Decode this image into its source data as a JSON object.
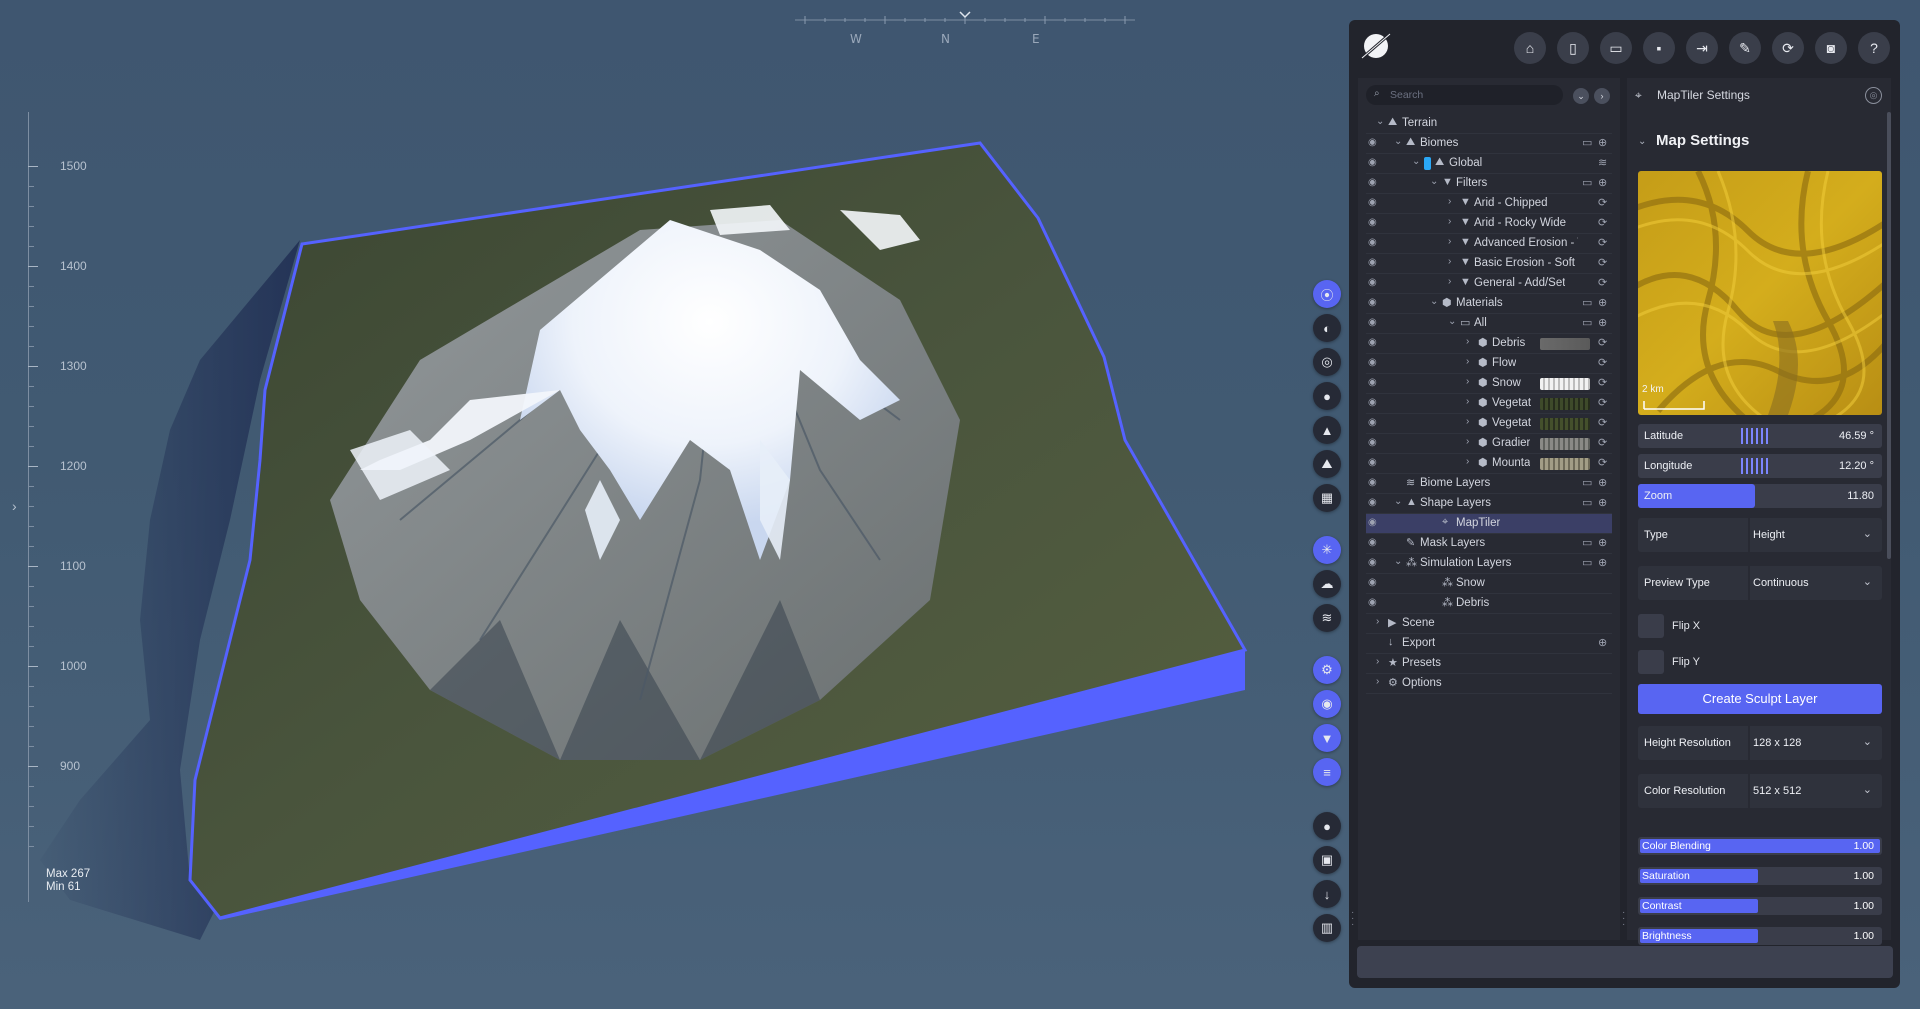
{
  "viewport": {
    "compass": {
      "w": "W",
      "n": "N",
      "e": "E"
    },
    "elevation_ticks": [
      "1500",
      "1400",
      "1300",
      "1200",
      "1100",
      "1000",
      "900"
    ],
    "minmax": {
      "max": "Max 267",
      "min": "Min 61"
    },
    "colors": {
      "terrain_edge": "#5562ff",
      "background": "#415a72"
    }
  },
  "toolstrip": [
    {
      "icon": "compass-icon",
      "active": true
    },
    {
      "icon": "globe-icon",
      "active": false
    },
    {
      "icon": "target-icon",
      "active": false
    },
    {
      "icon": "water-drop-icon",
      "active": false
    },
    {
      "icon": "mountain-icon",
      "active": false
    },
    {
      "icon": "landscape-icon",
      "active": false
    },
    {
      "icon": "grid-icon",
      "active": false
    },
    {
      "icon": "sun-icon",
      "active": true
    },
    {
      "icon": "cloud-icon",
      "active": false
    },
    {
      "icon": "wind-icon",
      "active": false
    },
    {
      "icon": "settings-gears-icon",
      "active": true
    },
    {
      "icon": "eye-icon",
      "active": true
    },
    {
      "icon": "filter-icon",
      "active": true
    },
    {
      "icon": "layers-icon",
      "active": true
    },
    {
      "icon": "record-icon",
      "active": false
    },
    {
      "icon": "image-icon",
      "active": false
    },
    {
      "icon": "download-icon",
      "active": false
    },
    {
      "icon": "chart-icon",
      "active": false
    }
  ],
  "toolbar": [
    "home-icon",
    "new-file-icon",
    "open-folder-icon",
    "save-icon",
    "export-file-icon",
    "edit-file-icon",
    "refresh-icon",
    "camera-icon",
    "help-icon"
  ],
  "search": {
    "placeholder": "Search"
  },
  "tree": [
    {
      "label": "Terrain",
      "indent": 0,
      "eye": false,
      "chev": "down",
      "icon": "terrain"
    },
    {
      "label": "Biomes",
      "indent": 1,
      "eye": true,
      "chev": "down",
      "icon": "biome",
      "act1": "folder",
      "act2": "plus"
    },
    {
      "label": "Global",
      "indent": 2,
      "eye": true,
      "chev": "down",
      "icon": "biome",
      "tag": true,
      "act2": "layers"
    },
    {
      "label": "Filters",
      "indent": 3,
      "eye": true,
      "chev": "down",
      "icon": "filter",
      "act1": "folder",
      "act2": "plus"
    },
    {
      "label": "Arid - Chipped",
      "indent": 4,
      "eye": true,
      "chev": "right",
      "icon": "filter",
      "act2": "sync"
    },
    {
      "label": "Arid - Rocky Wide",
      "indent": 4,
      "eye": true,
      "chev": "right",
      "icon": "filter",
      "act2": "sync"
    },
    {
      "label": "Advanced Erosion - W",
      "indent": 4,
      "eye": true,
      "chev": "right",
      "icon": "filter",
      "act2": "sync"
    },
    {
      "label": "Basic Erosion - Soft Fl",
      "indent": 4,
      "eye": true,
      "chev": "right",
      "icon": "filter",
      "act2": "sync"
    },
    {
      "label": "General - Add/Set",
      "indent": 4,
      "eye": true,
      "chev": "right",
      "icon": "filter",
      "act2": "sync"
    },
    {
      "label": "Materials",
      "indent": 3,
      "eye": true,
      "chev": "down",
      "icon": "material",
      "act1": "folder",
      "act2": "plus"
    },
    {
      "label": "All",
      "indent": 4,
      "eye": true,
      "chev": "down",
      "icon": "folder",
      "act1": "folder",
      "act2": "plus"
    },
    {
      "label": "Debris",
      "indent": 5,
      "eye": true,
      "chev": "right",
      "icon": "material",
      "act2": "sync",
      "swatch": "linear-gradient(90deg,#6a6a6a,#5a5a5a)"
    },
    {
      "label": "Flow",
      "indent": 5,
      "eye": true,
      "chev": "right",
      "icon": "material",
      "act2": "sync"
    },
    {
      "label": "Snow",
      "indent": 5,
      "eye": true,
      "chev": "right",
      "icon": "material",
      "act2": "sync",
      "swatch": "repeating-linear-gradient(90deg,#f2f2f2 0 3px,#bdbdbd 3px 5px)"
    },
    {
      "label": "Vegetat",
      "indent": 5,
      "eye": true,
      "chev": "right",
      "icon": "material",
      "act2": "sync",
      "swatch": "repeating-linear-gradient(90deg,#3e4a2a 0 3px,#262c1c 3px 5px)"
    },
    {
      "label": "Vegetat",
      "indent": 5,
      "eye": true,
      "chev": "right",
      "icon": "material",
      "act2": "sync",
      "swatch": "repeating-linear-gradient(90deg,#44502c 0 3px,#2a3020 3px 5px)"
    },
    {
      "label": "Gradier",
      "indent": 5,
      "eye": true,
      "chev": "right",
      "icon": "material",
      "act2": "sync",
      "swatch": "repeating-linear-gradient(90deg,#8a8a86 0 3px,#5e605c 3px 5px)"
    },
    {
      "label": "Mounta",
      "indent": 5,
      "eye": true,
      "chev": "right",
      "icon": "material",
      "act2": "sync",
      "swatch": "repeating-linear-gradient(90deg,#a29d86 0 3px,#6e6a58 3px 5px)"
    },
    {
      "label": "Biome Layers",
      "indent": 1,
      "eye": true,
      "chev": "",
      "icon": "layers",
      "act1": "folder",
      "act2": "plus"
    },
    {
      "label": "Shape Layers",
      "indent": 1,
      "eye": true,
      "chev": "down",
      "icon": "mountain",
      "act1": "folder",
      "act2": "plus"
    },
    {
      "label": "MapTiler",
      "indent": 3,
      "eye": true,
      "chev": "",
      "icon": "pin",
      "selected": true
    },
    {
      "label": "Mask Layers",
      "indent": 1,
      "eye": true,
      "chev": "",
      "icon": "brush",
      "act1": "folder",
      "act2": "plus"
    },
    {
      "label": "Simulation Layers",
      "indent": 1,
      "eye": true,
      "chev": "down",
      "icon": "sim",
      "act1": "folder",
      "act2": "plus"
    },
    {
      "label": "Snow",
      "indent": 3,
      "eye": true,
      "chev": "",
      "icon": "sim"
    },
    {
      "label": "Debris",
      "indent": 3,
      "eye": true,
      "chev": "",
      "icon": "sim"
    },
    {
      "label": "Scene",
      "indent": 0,
      "eye": false,
      "chev": "right",
      "icon": "camera"
    },
    {
      "label": "Export",
      "indent": 0,
      "eye": false,
      "chev": "",
      "icon": "download",
      "act2": "plus"
    },
    {
      "label": "Presets",
      "indent": 0,
      "eye": false,
      "chev": "right",
      "icon": "star"
    },
    {
      "label": "Options",
      "indent": 0,
      "eye": false,
      "chev": "right",
      "icon": "gear"
    }
  ],
  "settings": {
    "panel_title": "MapTiler Settings",
    "section_title": "Map Settings",
    "scale_label": "2 km",
    "latitude": {
      "label": "Latitude",
      "value": "46.59 °"
    },
    "longitude": {
      "label": "Longitude",
      "value": "12.20 °"
    },
    "zoom": {
      "label": "Zoom",
      "value": "11.80",
      "level": 0.48
    },
    "type": {
      "label": "Type",
      "value": "Height"
    },
    "preview_type": {
      "label": "Preview Type",
      "value": "Continuous"
    },
    "flip_x": "Flip X",
    "flip_y": "Flip Y",
    "create_button": "Create Sculpt Layer",
    "height_resolution": {
      "label": "Height Resolution",
      "value": "128 x 128"
    },
    "color_resolution": {
      "label": "Color Resolution",
      "value": "512 x 512"
    },
    "sliders": [
      {
        "label": "Color Blending",
        "value": "1.00",
        "level": 1.0
      },
      {
        "label": "Saturation",
        "value": "1.00",
        "level": 0.5
      },
      {
        "label": "Contrast",
        "value": "1.00",
        "level": 0.5
      },
      {
        "label": "Brightness",
        "value": "1.00",
        "level": 0.5
      }
    ]
  }
}
